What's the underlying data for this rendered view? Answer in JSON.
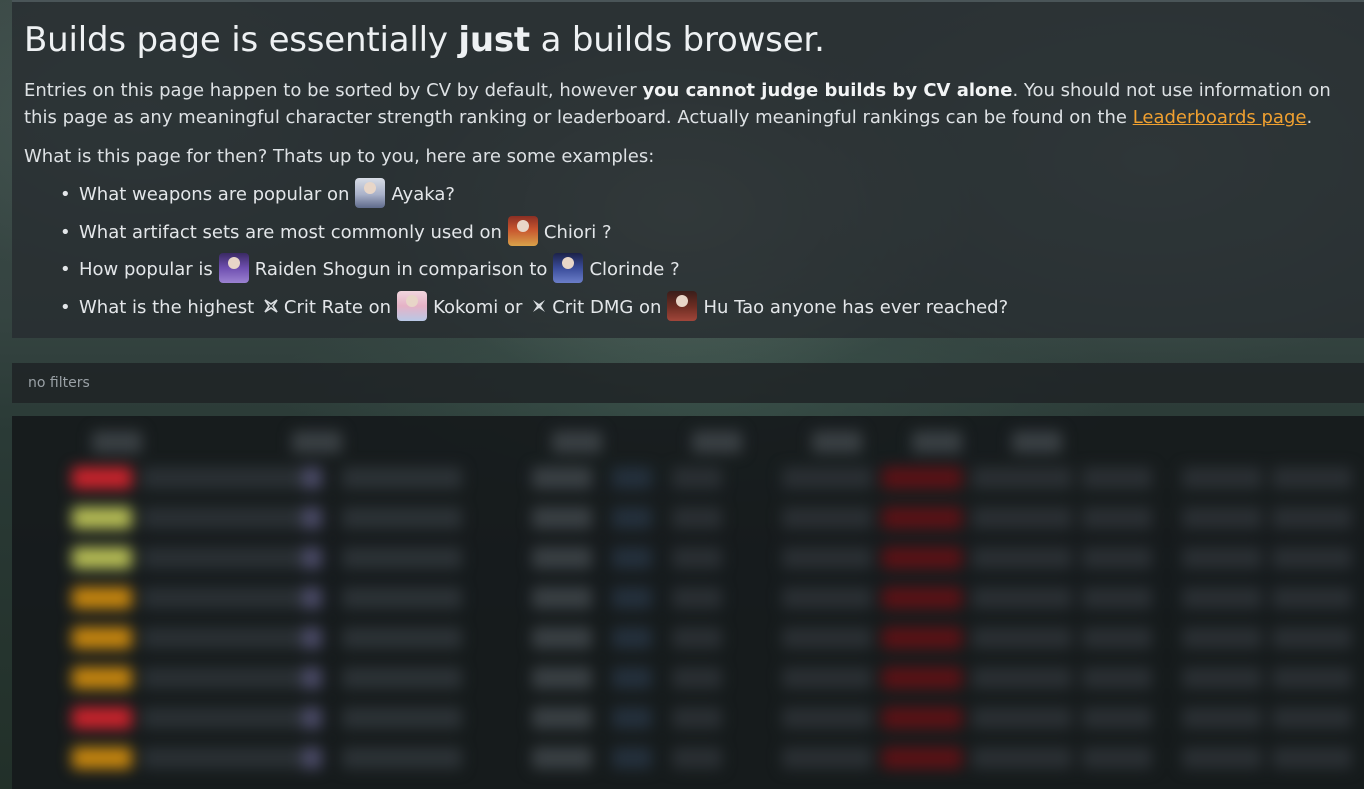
{
  "info": {
    "heading_pre": "Builds page is essentially ",
    "heading_bold": "just",
    "heading_post": " a builds browser.",
    "desc_part1": "Entries on this page happen to be sorted by CV by default, however ",
    "desc_bold": "you cannot judge builds by CV alone",
    "desc_part2": ". You should not use information on this page as any meaningful character strength ranking or leaderboard. Actually meaningful rankings can be found on the ",
    "desc_link": "Leaderboards page",
    "desc_end": ".",
    "question": "What is this page for then? Thats up to you, here are some examples:",
    "examples": [
      {
        "a": "What weapons are popular on",
        "char": "Ayaka",
        "b": "?"
      },
      {
        "a": "What artifact sets are most commonly used on",
        "char": "Chiori",
        "b": " ?"
      },
      {
        "a": "How popular is",
        "char": "Raiden Shogun",
        "b": "in comparison to",
        "char2": "Clorinde",
        "c": " ?"
      },
      {
        "a": "What is the highest",
        "stat1": "Crit Rate",
        "b": "on",
        "char": "Kokomi",
        "c": "or",
        "stat2": "Crit DMG",
        "d": "on",
        "char2": "Hu Tao",
        "e": "anyone has ever reached?"
      }
    ],
    "icons": {
      "ayaka": "ayaka-portrait-icon",
      "chiori": "chiori-portrait-icon",
      "raiden": "raiden-shogun-portrait-icon",
      "clorinde": "clorinde-portrait-icon",
      "kokomi": "kokomi-portrait-icon",
      "hutao": "hu-tao-portrait-icon",
      "crit_rate": "crit-rate-icon",
      "crit_dmg": "crit-dmg-icon"
    },
    "link_color": "#f0a030"
  },
  "filters": {
    "label": "no filters"
  },
  "table": {
    "state": "blurred",
    "rank_colors": [
      "#c8232c",
      "#b6bd55",
      "#b6bd55",
      "#c6860f",
      "#c6860f",
      "#c6860f",
      "#c8232c",
      "#c6860f"
    ]
  }
}
